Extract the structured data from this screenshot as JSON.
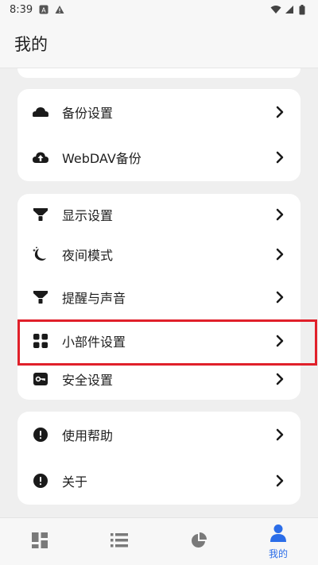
{
  "status_bar": {
    "time": "8:39"
  },
  "header": {
    "title": "我的"
  },
  "groups": [
    {
      "items": [
        {
          "label": "备份设置",
          "icon": "cloud-icon"
        },
        {
          "label": "WebDAV备份",
          "icon": "cloud-upload-icon"
        }
      ]
    },
    {
      "items": [
        {
          "label": "显示设置",
          "icon": "funnel-icon"
        },
        {
          "label": "夜间模式",
          "icon": "moon-icon"
        },
        {
          "label": "提醒与声音",
          "icon": "funnel-icon"
        },
        {
          "label": "小部件设置",
          "icon": "widgets-icon"
        },
        {
          "label": "安全设置",
          "icon": "key-icon"
        }
      ]
    },
    {
      "items": [
        {
          "label": "使用帮助",
          "icon": "alert-circle-icon"
        },
        {
          "label": "关于",
          "icon": "alert-circle-icon"
        }
      ]
    }
  ],
  "bottom_nav": {
    "items": [
      {
        "icon": "dashboard-icon",
        "label": ""
      },
      {
        "icon": "list-icon",
        "label": ""
      },
      {
        "icon": "pie-chart-icon",
        "label": ""
      },
      {
        "icon": "person-icon",
        "label": "我的",
        "active": true
      }
    ]
  },
  "colors": {
    "accent": "#2b6de8",
    "highlight": "#e0202a",
    "icon": "#1a1a1a"
  }
}
